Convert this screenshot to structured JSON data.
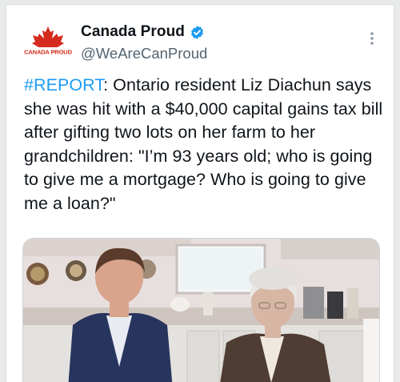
{
  "account": {
    "display_name": "Canada Proud",
    "handle": "@WeAreCanProud",
    "avatar_text": "CANADA PROUD",
    "verified_icon": "verified-badge-icon",
    "more_icon": "more-vertical-icon"
  },
  "tweet": {
    "hashtag": "#REPORT",
    "text": ": Ontario resident Liz Diachun says she was hit with a $40,000 capital gains tax bill after gifting two lots on her farm to her grandchildren: \"I’m 93 years old; who is going to give me a mortgage? Who is going to give me a loan?\""
  },
  "media": {
    "type": "video-still",
    "subject": "kitchen-interview"
  },
  "colors": {
    "link": "#1d9bf0",
    "text": "#0f1419",
    "secondary": "#536471",
    "brand_red": "#d52b1e"
  }
}
